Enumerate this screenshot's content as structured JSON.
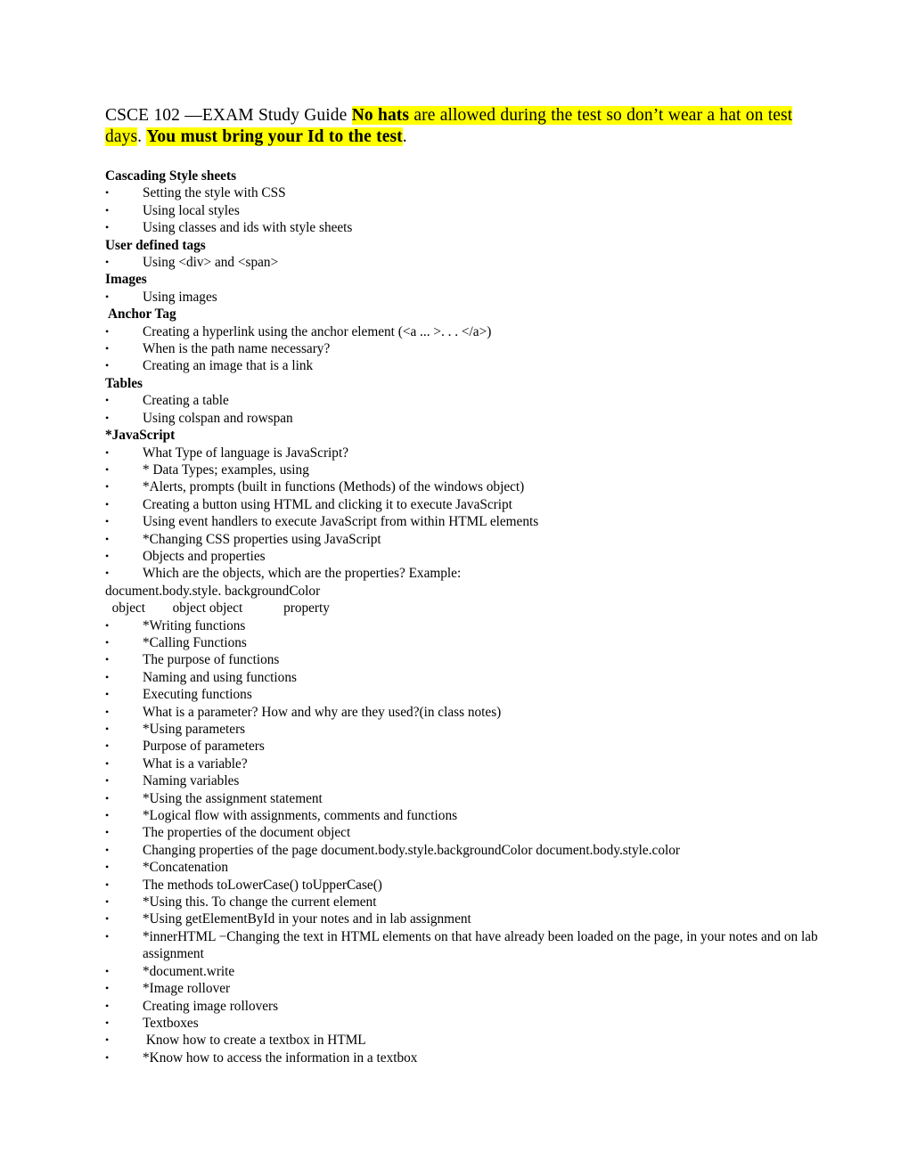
{
  "document": {
    "title_line1_prefix": "CSCE 102 —EXAM Study Guide ",
    "title_hl_bold_1": "No hats",
    "title_hl_1": " are allowed during the test so don’t wear ",
    "title_hl_2": "a hat on test days",
    "title_after_days": ". ",
    "title_hl_bold_2": "You must bring your Id to the test",
    "title_end": ".",
    "highlight_color": "#FFFF00",
    "bullet_glyph": "•"
  },
  "sections": [
    {
      "heading": "Cascading Style sheets",
      "items": [
        "Setting the style with CSS",
        "Using local styles",
        "Using classes and ids with style sheets"
      ]
    },
    {
      "heading": "User defined tags",
      "items": [
        "Using <div> and <span>"
      ]
    },
    {
      "heading": "Images",
      "items": [
        "Using images"
      ]
    },
    {
      "heading": " Anchor Tag",
      "items": [
        "Creating a hyperlink using the anchor element (<a ... >. . . </a>)",
        "When is the path name necessary?",
        "Creating an image that is a link"
      ]
    },
    {
      "heading": "Tables",
      "items": [
        "Creating a table",
        "Using colspan and rowspan"
      ]
    },
    {
      "heading": "*JavaScript",
      "items": [
        "What Type of language is JavaScript?",
        "* Data Types; examples, using",
        "*Alerts, prompts (built in functions (Methods) of the windows object)",
        "Creating a button using HTML and clicking it to execute JavaScript",
        "Using event handlers to execute JavaScript from within HTML elements",
        "*Changing CSS properties using JavaScript",
        "Objects and properties",
        "Which are the objects, which are the properties? Example:"
      ]
    }
  ],
  "example_lines": {
    "line1": "document.body.style. backgroundColor",
    "line2": "  object        object object            property"
  },
  "tail_items": [
    "*Writing functions",
    "*Calling Functions",
    "The purpose of functions",
    "Naming and using functions",
    "Executing functions",
    "What is a parameter? How and why are they used?(in class notes)",
    "*Using parameters",
    "Purpose of parameters",
    "What is a variable?",
    "Naming variables",
    "*Using the assignment statement",
    "*Logical flow with assignments, comments and functions",
    "The properties of the document object",
    "Changing properties of the page document.body.style.backgroundColor document.body.style.color",
    "*Concatenation",
    "The methods toLowerCase() toUpperCase()",
    "*Using this. To change the current element",
    "*Using getElementById in your notes and in lab assignment",
    "*innerHTML −Changing the text in HTML elements on that have already been loaded on the page, in your notes and on lab assignment",
    "*document.write",
    "*Image rollover",
    "Creating image rollovers",
    "Textboxes",
    " Know how to create a textbox in HTML",
    "*Know how to access the information in a textbox"
  ]
}
